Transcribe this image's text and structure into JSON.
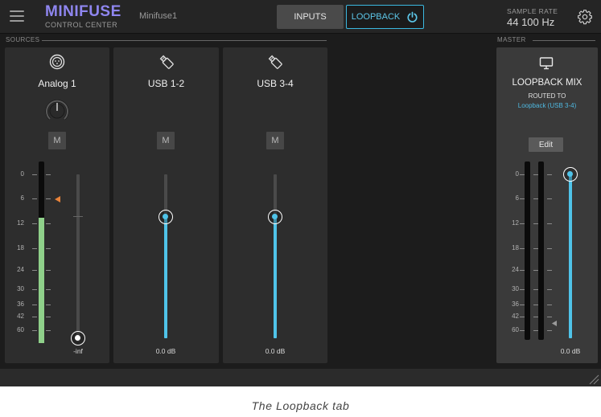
{
  "topbar": {
    "brand_name": "MINIFUSE",
    "brand_sub": "CONTROL CENTER",
    "device_name": "Minifuse1",
    "tab_inputs": "INPUTS",
    "tab_loopback": "LOOPBACK",
    "sample_rate_label": "SAMPLE RATE",
    "sample_rate_value": "44 100 Hz"
  },
  "sections": {
    "sources": "SOURCES",
    "master": "MASTER"
  },
  "sources": [
    {
      "name": "Analog 1",
      "icon": "xlr-jack-icon",
      "mute": "M",
      "volume": "-inf",
      "volume_fraction": 0.0
    },
    {
      "name": "USB 1-2",
      "icon": "usb-icon",
      "mute": "M",
      "volume": "0.0 dB",
      "volume_fraction": 0.74
    },
    {
      "name": "USB 3-4",
      "icon": "usb-icon",
      "mute": "M",
      "volume": "0.0 dB",
      "volume_fraction": 0.74
    }
  ],
  "master": {
    "icon": "monitor-icon",
    "title": "LOOPBACK MIX",
    "routed_to_label": "ROUTED TO",
    "routed_to_value": "Loopback (USB 3-4)",
    "edit_label": "Edit",
    "volume": "0.0 dB",
    "volume_fraction": 1.0
  },
  "meter_scale": [
    "0",
    "6",
    "12",
    "18",
    "24",
    "30",
    "36",
    "42",
    "60"
  ],
  "analog_meter_level_db": "12",
  "caption": "The Loopback tab",
  "colors": {
    "accent": "#4fc3e8",
    "brand": "#8f86f0",
    "meter_green": "#8fd08a",
    "peak_marker": "#e8833a"
  }
}
